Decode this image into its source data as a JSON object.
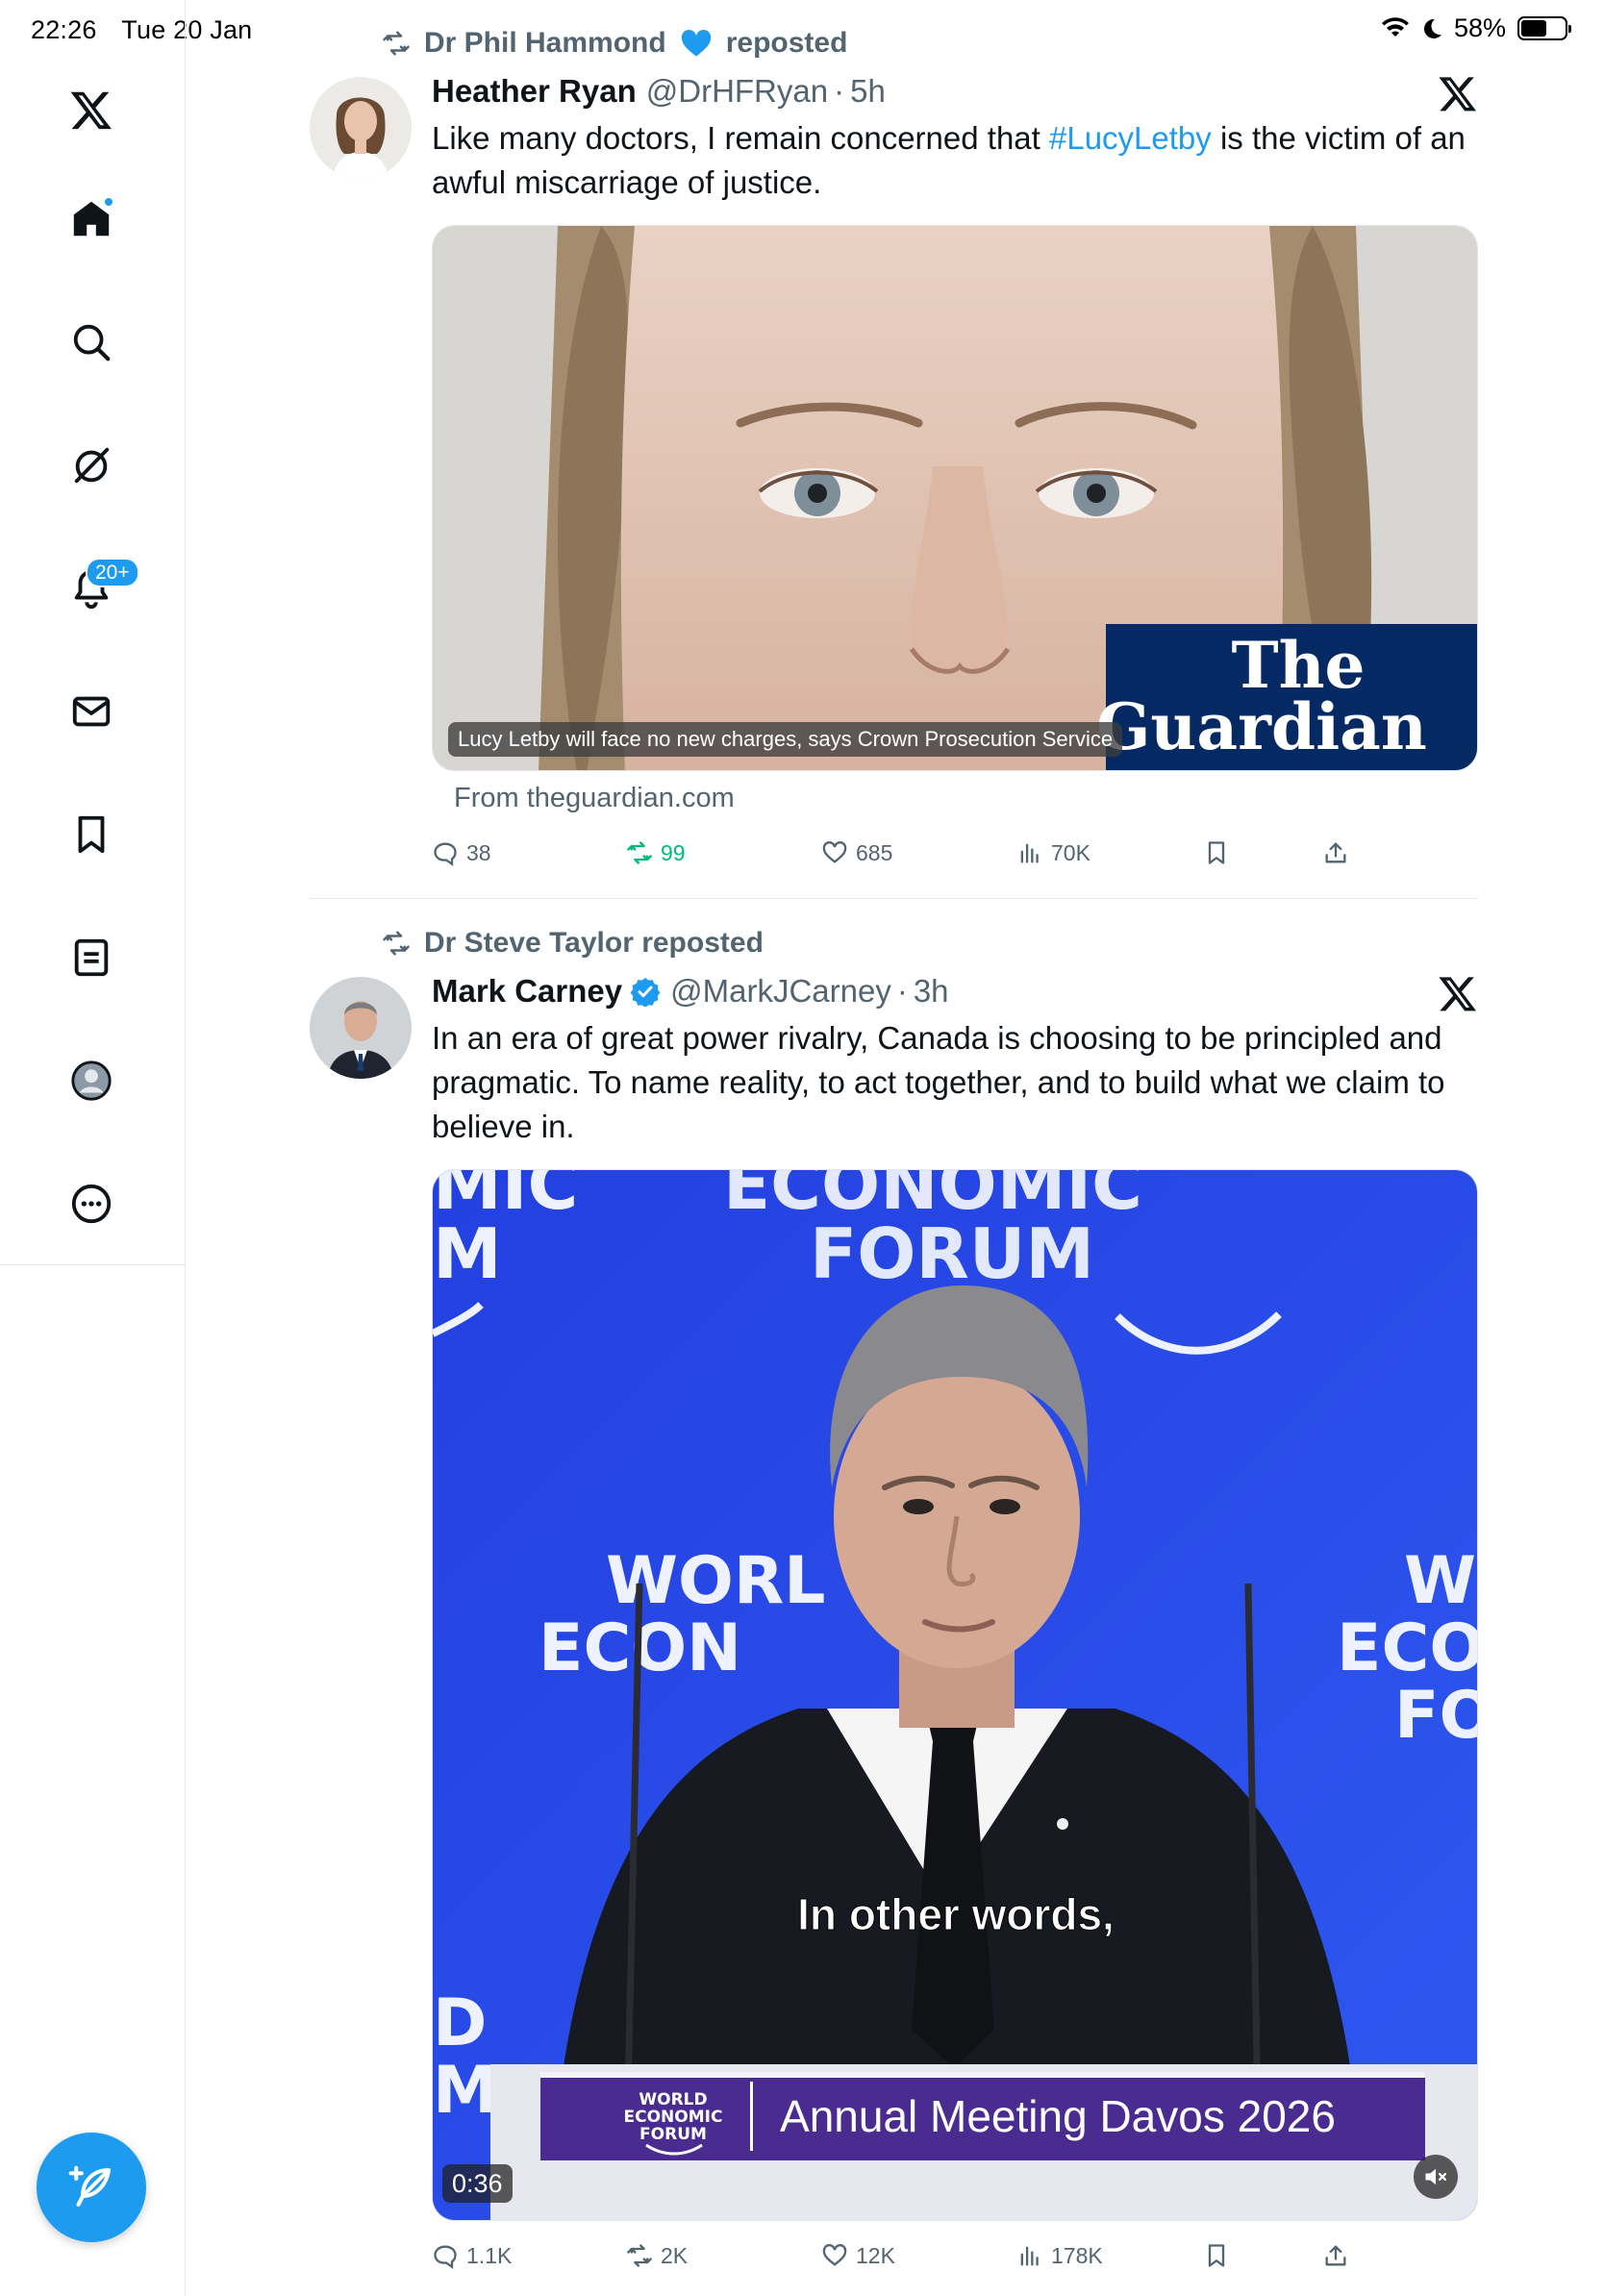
{
  "status_bar": {
    "time": "22:26",
    "date": "Tue 20 Jan",
    "battery": "58%",
    "battery_level": 0.58
  },
  "sidebar": {
    "items": [
      {
        "name": "home",
        "icon": "home-icon"
      },
      {
        "name": "search",
        "icon": "search-icon"
      },
      {
        "name": "grok",
        "icon": "grok-icon"
      },
      {
        "name": "notifications",
        "icon": "bell-icon",
        "badge": "20+"
      },
      {
        "name": "messages",
        "icon": "mail-icon"
      },
      {
        "name": "bookmarks",
        "icon": "bookmark-icon"
      },
      {
        "name": "lists",
        "icon": "list-icon"
      },
      {
        "name": "profile",
        "icon": "profile-icon"
      },
      {
        "name": "more",
        "icon": "more-icon"
      }
    ],
    "compose_icon": "feather-plus-icon"
  },
  "tweets": [
    {
      "reposted_by": "Dr Phil Hammond",
      "reposted_suffix": "reposted",
      "author_name": "Heather Ryan",
      "handle": "@DrHFRyan",
      "sep": "·",
      "time": "5h",
      "text_before": "Like many doctors, I remain concerned that ",
      "hashtag": "#LucyLetby",
      "text_after": " is the victim of an awful miscarriage of justice.",
      "card_caption": "Lucy Letby will face no new charges, says Crown Prosecution Service",
      "brand_line1": "The",
      "brand_line2": "Guardian",
      "source": "From theguardian.com",
      "stats": {
        "replies": "38",
        "reposts": "99",
        "likes": "685",
        "views": "70K"
      }
    },
    {
      "reposted_by": "Dr Steve Taylor reposted",
      "author_name": "Mark Carney",
      "handle": "@MarkJCarney",
      "sep": "·",
      "time": "3h",
      "text": "In an era of great power rivalry, Canada is choosing to be principled and pragmatic. To name reality, to act together, and to build what we claim to believe in.",
      "video": {
        "backdrop_top": "ECONOMIC",
        "backdrop_top2": "FORUM",
        "backdrop_top_left": "MIC",
        "backdrop_top_left2": "M",
        "backdrop_mid_left": "WORL",
        "backdrop_mid_left2": "ECON",
        "backdrop_mid_right": "W",
        "backdrop_mid_right2": "ECO",
        "backdrop_mid_right3": "FO",
        "subtitle": "In other words,",
        "podium_logo_1": "WORLD",
        "podium_logo_2": "ECONOMIC",
        "podium_logo_3": "FORUM",
        "podium_banner": "Annual Meeting Davos 2026",
        "duration": "0:36"
      },
      "stats": {
        "replies": "1.1K",
        "reposts": "2K",
        "likes": "12K",
        "views": "178K"
      }
    }
  ],
  "colors": {
    "accent": "#1d9bf0",
    "repost_green": "#00ba7c",
    "muted": "#536471",
    "guardian_blue": "#052962",
    "wef_blue": "#2c4fe0"
  }
}
